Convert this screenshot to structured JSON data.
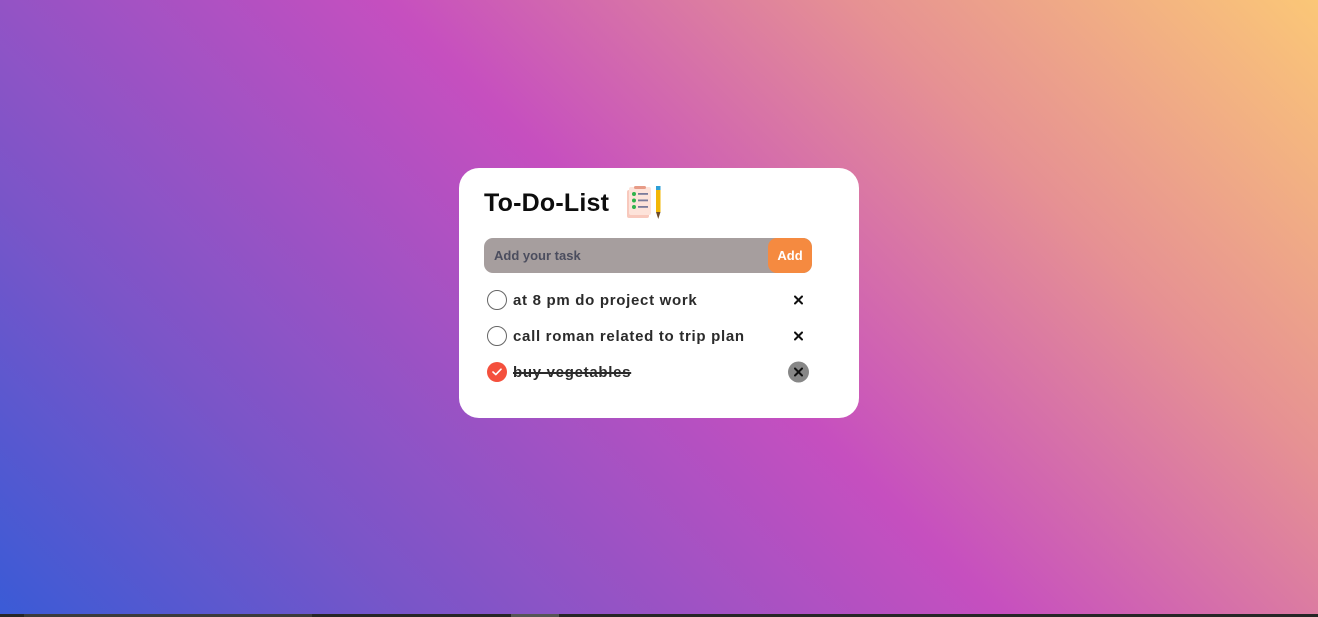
{
  "app": {
    "title": "To-Do-List",
    "icon": "checklist-pencil-icon"
  },
  "input": {
    "placeholder": "Add your task",
    "value": "",
    "add_label": "Add"
  },
  "tasks": [
    {
      "text": "at 8 pm do project work",
      "completed": false
    },
    {
      "text": "call roman related to trip plan",
      "completed": false
    },
    {
      "text": "buy vegetables",
      "completed": true
    }
  ],
  "colors": {
    "accent": "#f58a40",
    "check_done": "#f4503d",
    "input_bg": "#a69e9e",
    "card_bg": "#ffffff",
    "gradient": [
      "#3a5bd6",
      "#c64fbf",
      "#fbc777"
    ]
  }
}
